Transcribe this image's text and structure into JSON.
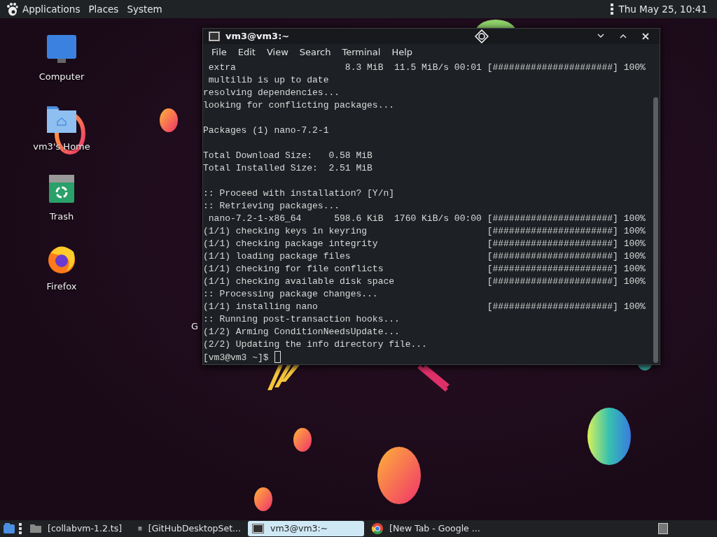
{
  "top_panel": {
    "menus": [
      "Applications",
      "Places",
      "System"
    ],
    "clock": "Thu May 25, 10:41"
  },
  "desktop_icons": [
    {
      "label": "Computer",
      "kind": "computer"
    },
    {
      "label": "vm3's Home",
      "kind": "home"
    },
    {
      "label": "Trash",
      "kind": "trash"
    },
    {
      "label": "Firefox",
      "kind": "firefox"
    }
  ],
  "covered_icon_label": "G",
  "terminal": {
    "title": "vm3@vm3:~",
    "menu": [
      "File",
      "Edit",
      "View",
      "Search",
      "Terminal",
      "Help"
    ],
    "blocks": [
      [
        " extra                    8.3 MiB  11.5 MiB/s 00:01 [######################] 100%",
        " multilib is up to date",
        "resolving dependencies...",
        "looking for conflicting packages..."
      ],
      [
        "Packages (1) nano-7.2-1"
      ],
      [
        "Total Download Size:   0.58 MiB",
        "Total Installed Size:  2.51 MiB"
      ],
      [
        ":: Proceed with installation? [Y/n]",
        ":: Retrieving packages...",
        " nano-7.2-1-x86_64      598.6 KiB  1760 KiB/s 00:00 [######################] 100%",
        "(1/1) checking keys in keyring                      [######################] 100%",
        "(1/1) checking package integrity                    [######################] 100%",
        "(1/1) loading package files                         [######################] 100%",
        "(1/1) checking for file conflicts                   [######################] 100%",
        "(1/1) checking available disk space                 [######################] 100%",
        ":: Processing package changes...",
        "(1/1) installing nano                               [######################] 100%",
        ":: Running post-transaction hooks...",
        "(1/2) Arming ConditionNeedsUpdate...",
        "(2/2) Updating the info directory file..."
      ]
    ],
    "prompt": "[vm3@vm3 ~]$"
  },
  "taskbar": {
    "items": [
      {
        "label": "[collabvm-1.2.ts]",
        "kind": "folder",
        "selected": false
      },
      {
        "label": "[GitHubDesktopSet...",
        "kind": "installer",
        "selected": false
      },
      {
        "label": "vm3@vm3:~",
        "kind": "terminal",
        "selected": true
      },
      {
        "label": "[New Tab - Google ...",
        "kind": "browser",
        "selected": false
      }
    ]
  }
}
